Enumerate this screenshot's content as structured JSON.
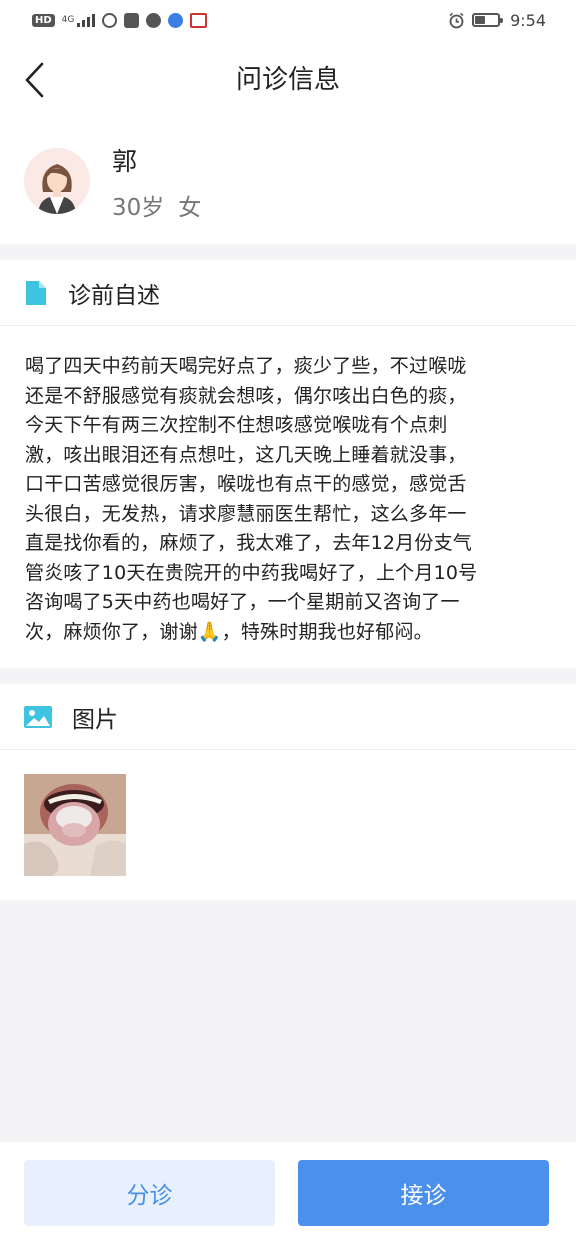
{
  "status_bar": {
    "hd": "HD",
    "network": "4G",
    "time": "9:54",
    "icons": [
      "hd-icon",
      "signal-icon",
      "app-icon",
      "coffee-icon",
      "chat-icon",
      "music-icon",
      "calendar-icon",
      "alarm-icon",
      "battery-icon"
    ],
    "battery_level": 0.45
  },
  "header": {
    "title": "问诊信息",
    "back_icon": "chevron-left-icon"
  },
  "patient": {
    "name": "郭",
    "age": "30岁",
    "gender": "女",
    "avatar_icon": "female-avatar-icon"
  },
  "complaint": {
    "title": "诊前自述",
    "icon": "document-icon",
    "lines": [
      "喝了四天中药前天喝完好点了，痰少了些，不过喉咙",
      "还是不舒服感觉有痰就会想咳，偶尔咳出白色的痰，",
      "今天下午有两三次控制不住想咳感觉喉咙有个点刺",
      "激，咳出眼泪还有点想吐，这几天晚上睡着就没事，",
      "口干口苦感觉很厉害，喉咙也有点干的感觉，感觉舌",
      "头很白，无发热，请求廖慧丽医生帮忙，这么多年一",
      "直是找你看的，麻烦了，我太难了，去年12月份支气",
      "管炎咳了10天在贵院开的中药我喝好了，上个月10号",
      "咨询喝了5天中药也喝好了，一个星期前又咨询了一",
      "次，麻烦你了，谢谢🙏，特殊时期我也好郁闷。"
    ]
  },
  "images": {
    "title": "图片",
    "icon": "image-icon",
    "thumbnail_icon": "tongue-photo-icon"
  },
  "actions": {
    "triage_label": "分诊",
    "accept_label": "接诊"
  },
  "colors": {
    "accent": "#4a90ec",
    "accent_light": "#e7f0fc",
    "section_icon": "#3ec3e0",
    "background": "#f4f4f6"
  }
}
